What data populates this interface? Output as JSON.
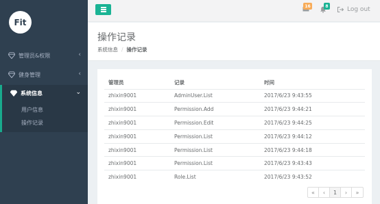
{
  "app": {
    "logo_text": "Fit"
  },
  "sidebar": {
    "items": [
      {
        "label": "管理员&权限",
        "icon": "diamond-icon",
        "chevron": "‹"
      },
      {
        "label": "健身管理",
        "icon": "diamond-icon",
        "chevron": "‹"
      },
      {
        "label": "系统信息",
        "icon": "diamond-icon",
        "chevron": "⌄",
        "active": true
      }
    ],
    "sub_items": [
      {
        "label": "用户信息"
      },
      {
        "label": "操作记录"
      }
    ]
  },
  "topbar": {
    "mail_count": "16",
    "alert_count": "8",
    "logout_label": "Log out"
  },
  "heading": {
    "title": "操作记录",
    "breadcrumb": [
      "系统信息",
      "操作记录"
    ]
  },
  "table": {
    "headers": [
      "管理员",
      "记录",
      "时间"
    ],
    "rows": [
      [
        "zhixin9001",
        "AdminUser.List",
        "2017/6/23 9:43:55"
      ],
      [
        "zhixin9001",
        "Permission.Add",
        "2017/6/23 9:44:21"
      ],
      [
        "zhixin9001",
        "Permission.Edit",
        "2017/6/23 9:44:25"
      ],
      [
        "zhixin9001",
        "Permission.List",
        "2017/6/23 9:44:12"
      ],
      [
        "zhixin9001",
        "Permission.List",
        "2017/6/23 9:44:18"
      ],
      [
        "zhixin9001",
        "Permission.List",
        "2017/6/23 9:43:43"
      ],
      [
        "zhixin9001",
        "Role.List",
        "2017/6/23 9:43:52"
      ]
    ]
  },
  "pagination": {
    "first": "«",
    "prev": "‹",
    "current": "1",
    "next": "›",
    "last": "»"
  },
  "colors": {
    "sidebar_bg": "#2f4050",
    "accent": "#1ab394",
    "mail_badge": "#f8ac59",
    "alert_badge": "#1ab394"
  }
}
